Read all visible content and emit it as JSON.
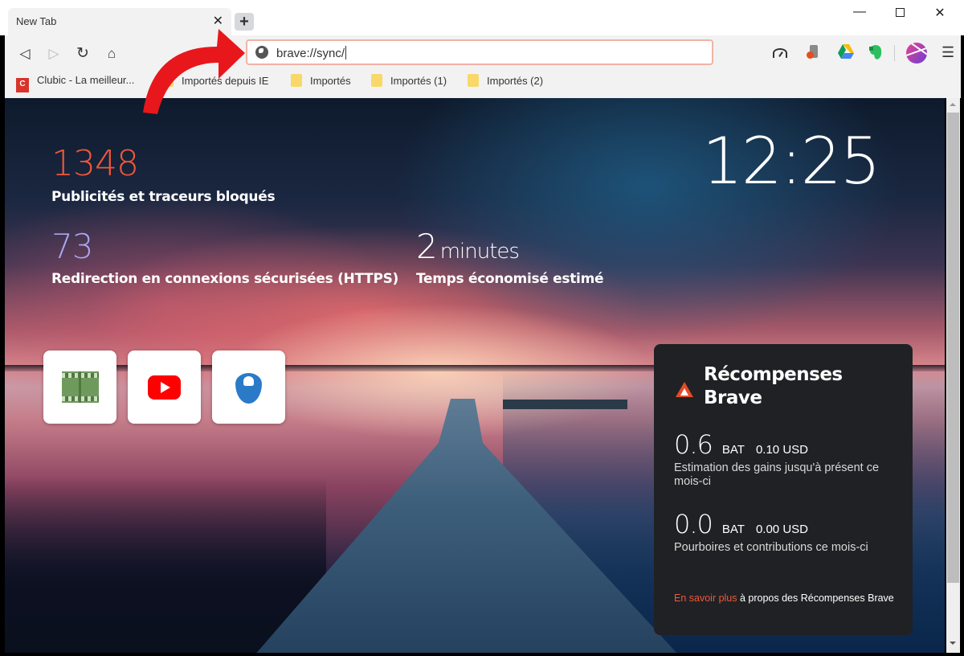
{
  "window": {
    "tab_title": "New Tab",
    "tab_close": "✕",
    "new_tab": "+",
    "minimize": "—",
    "close": "✕"
  },
  "toolbar": {
    "back": "◁",
    "forward": "▷",
    "reload": "↻",
    "home": "⌂",
    "address_value": "brave://sync/",
    "menu": "☰",
    "extensions": [
      "speedometer-icon",
      "office-icon",
      "google-drive-icon",
      "evernote-icon"
    ]
  },
  "bookmarks": [
    {
      "label": "Clubic - La meilleur...",
      "icon": "clubic-icon"
    },
    {
      "label": "Importés depuis IE",
      "icon": "folder-icon"
    },
    {
      "label": "Importés",
      "icon": "folder-icon"
    },
    {
      "label": "Importés (1)",
      "icon": "folder-icon"
    },
    {
      "label": "Importés (2)",
      "icon": "folder-icon"
    }
  ],
  "stats": {
    "ads_blocked": {
      "value": "1348",
      "label": "Publicités et traceurs bloqués",
      "color": "#f0583a"
    },
    "https": {
      "value": "73",
      "label": "Redirection en connexions sécurisées (HTTPS)",
      "color": "#a9a6f0"
    },
    "time_saved": {
      "value": "2",
      "unit": "minutes",
      "label": "Temps économisé estimé"
    }
  },
  "clock": "12:25",
  "top_sites": [
    {
      "name": "film-site",
      "icon": "film-strip-icon"
    },
    {
      "name": "youtube",
      "icon": "youtube-icon"
    },
    {
      "name": "water-drop-site",
      "icon": "water-drop-icon"
    }
  ],
  "rewards": {
    "title": "Récompenses Brave",
    "earnings": {
      "value": "0.6",
      "unit": "BAT",
      "usd": "0.10 USD",
      "desc": "Estimation des gains jusqu'à présent ce mois-ci"
    },
    "tips": {
      "value": "0.0",
      "unit": "BAT",
      "usd": "0.00 USD",
      "desc": "Pourboires et contributions ce mois-ci"
    },
    "learn_link": "En savoir plus",
    "learn_rest": " à propos des Récompenses Brave",
    "accent": "#f0583a"
  }
}
